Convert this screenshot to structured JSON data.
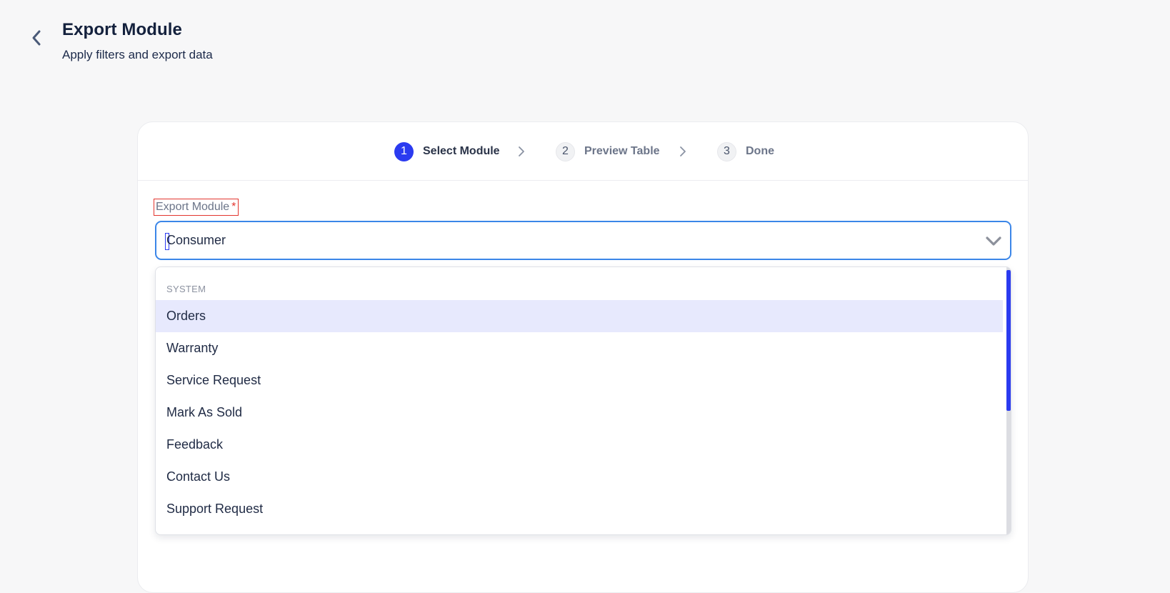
{
  "header": {
    "title": "Export Module",
    "subtitle": "Apply filters and export data"
  },
  "stepper": {
    "steps": [
      {
        "number": "1",
        "label": "Select Module",
        "active": true
      },
      {
        "number": "2",
        "label": "Preview Table",
        "active": false
      },
      {
        "number": "3",
        "label": "Done",
        "active": false
      }
    ]
  },
  "form": {
    "module_label": "Export Module",
    "required_mark": "*",
    "selected_value": "Consumer"
  },
  "dropdown": {
    "group_label": "SYSTEM",
    "options": [
      "Orders",
      "Warranty",
      "Service Request",
      "Mark As Sold",
      "Feedback",
      "Contact Us",
      "Support Request"
    ],
    "highlighted_index": 0
  },
  "colors": {
    "accent": "#2b3bf0",
    "focus_border": "#3b86e8",
    "required": "#e3362f",
    "highlight": "#e7e9fd"
  },
  "icons": {
    "back": "chevron-left-icon",
    "step_separator": "chevron-right-icon",
    "select_toggle": "chevron-down-icon"
  }
}
